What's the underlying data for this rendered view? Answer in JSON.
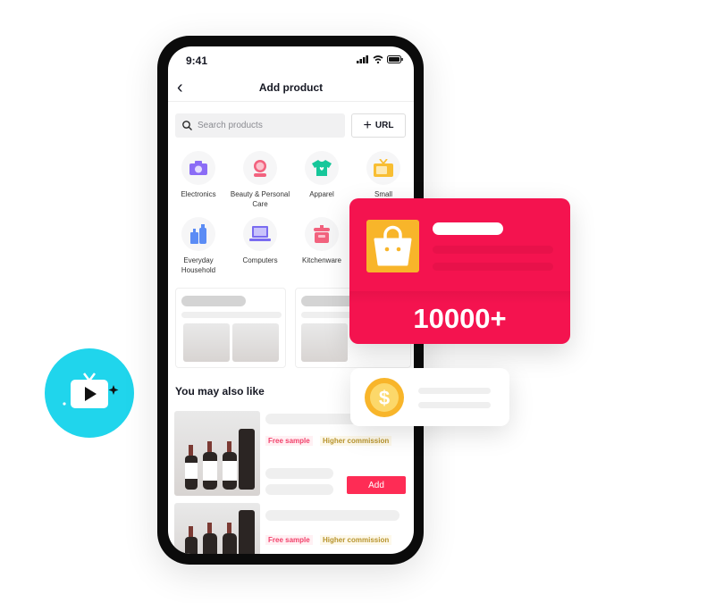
{
  "status_bar": {
    "time": "9:41"
  },
  "header": {
    "title": "Add product",
    "back_icon": "chevron-left-icon"
  },
  "search": {
    "placeholder": "Search products",
    "url_label": "URL"
  },
  "categories": [
    {
      "label": "Electronics",
      "icon": "camera-icon",
      "color": "#8b6cf6"
    },
    {
      "label": "Beauty & Personal Care",
      "icon": "mirror-icon",
      "color": "#f2627e"
    },
    {
      "label": "Apparel",
      "icon": "shirt-icon",
      "color": "#16c79a"
    },
    {
      "label": "Small",
      "icon": "tv-icon",
      "color": "#f8be33"
    },
    {
      "label": "Everyday Household",
      "icon": "bottles-icon",
      "color": "#5b8cf5"
    },
    {
      "label": "Computers",
      "icon": "laptop-icon",
      "color": "#7a6cf0"
    },
    {
      "label": "Kitchenware",
      "icon": "pot-icon",
      "color": "#f2627e"
    }
  ],
  "section": {
    "title": "You may also like"
  },
  "products": [
    {
      "tags": [
        "Free sample",
        "Higher commission"
      ],
      "add_label": "Add"
    },
    {
      "tags": [
        "Free sample",
        "Higher commission"
      ]
    }
  ],
  "promo": {
    "count": "10000+",
    "accent": "#f4134f"
  },
  "colors": {
    "brand": "#fe2c55",
    "cyan": "#20d5ec",
    "gold": "#f8be33"
  }
}
